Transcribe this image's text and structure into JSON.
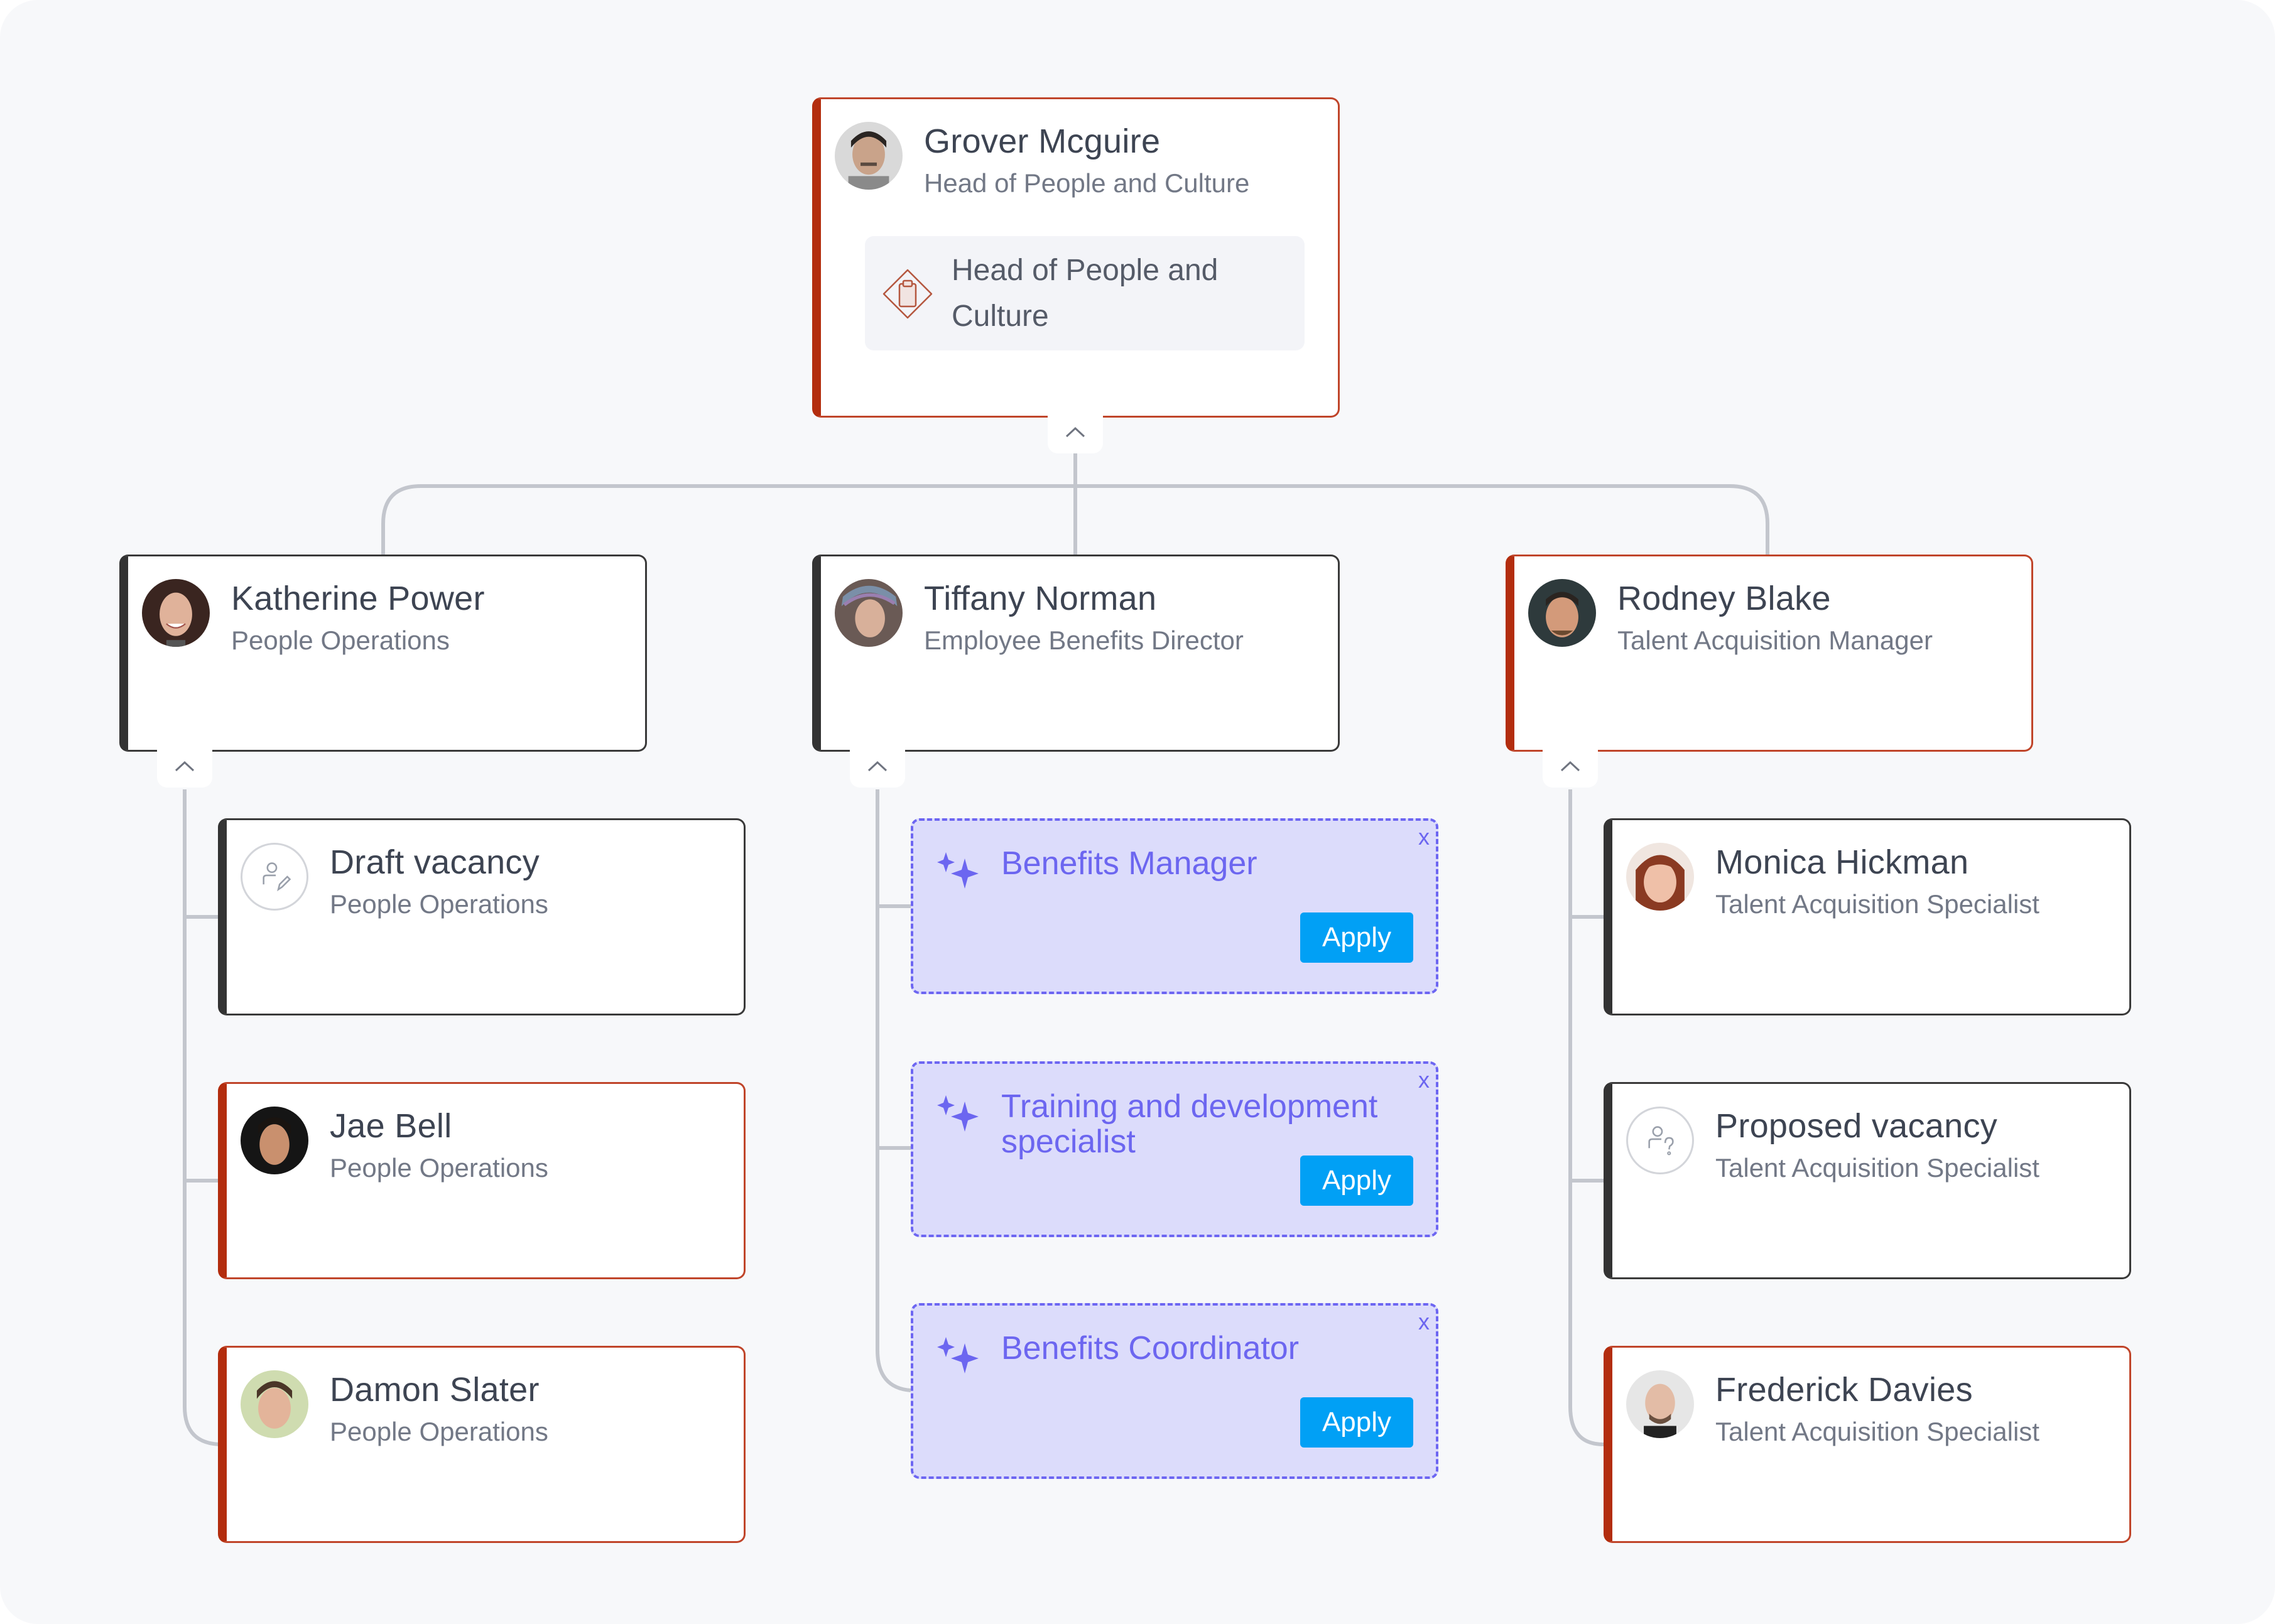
{
  "colors": {
    "background": "#f7f8fa",
    "card_border_default": "#333333",
    "card_border_accent": "#b32d0e",
    "connector": "#c3c6cd",
    "ai_suggestion_fill": "#dcdcfb",
    "ai_suggestion_accent": "#6c66f0",
    "apply_button": "#01a0f5"
  },
  "root": {
    "name": "Grover Mcguire",
    "role": "Head of People and Culture",
    "position_title": "Head of People and Culture",
    "position_icon": "clipboard-diamond-icon",
    "accent": true,
    "collapse_icon": "chevron-up-icon"
  },
  "managers": [
    {
      "name": "Katherine Power",
      "role": "People Operations",
      "accent": false,
      "collapse_icon": "chevron-up-icon",
      "reports": [
        {
          "type": "vacancy",
          "name": "Draft vacancy",
          "role": "People Operations",
          "icon": "person-edit-icon",
          "accent": false
        },
        {
          "type": "person",
          "name": "Jae Bell",
          "role": "People Operations",
          "accent": true
        },
        {
          "type": "person",
          "name": "Damon Slater",
          "role": "People Operations",
          "accent": true
        }
      ]
    },
    {
      "name": "Tiffany Norman",
      "role": "Employee Benefits Director",
      "accent": false,
      "collapse_icon": "chevron-up-icon",
      "suggestions": [
        {
          "title": "Benefits Manager",
          "apply_label": "Apply",
          "close_label": "x",
          "icon": "sparkle-icon"
        },
        {
          "title": "Training and development specialist",
          "apply_label": "Apply",
          "close_label": "x",
          "icon": "sparkle-icon"
        },
        {
          "title": "Benefits Coordinator",
          "apply_label": "Apply",
          "close_label": "x",
          "icon": "sparkle-icon"
        }
      ]
    },
    {
      "name": "Rodney Blake",
      "role": "Talent Acquisition Manager",
      "accent": true,
      "collapse_icon": "chevron-up-icon",
      "reports": [
        {
          "type": "person",
          "name": "Monica Hickman",
          "role": "Talent Acquisition Specialist",
          "accent": false
        },
        {
          "type": "vacancy",
          "name": "Proposed vacancy",
          "role": "Talent Acquisition Specialist",
          "icon": "person-question-icon",
          "accent": false
        },
        {
          "type": "person",
          "name": "Frederick Davies",
          "role": "Talent Acquisition Specialist",
          "accent": true
        }
      ]
    }
  ]
}
